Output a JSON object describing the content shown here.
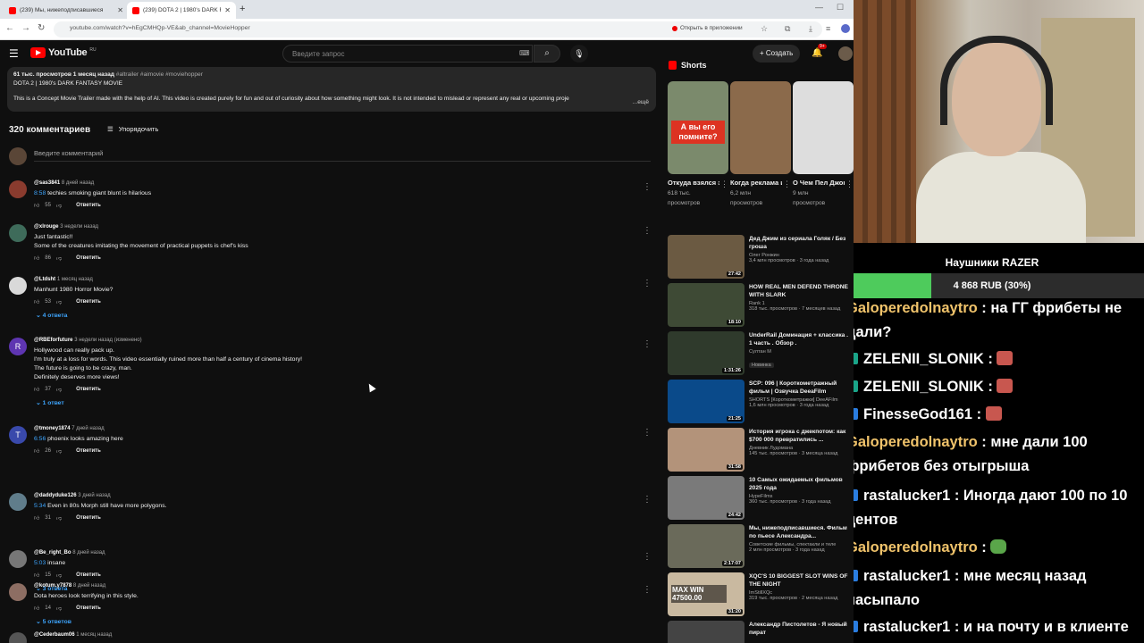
{
  "browser": {
    "tabs": [
      {
        "title": "(239) Мы, нижеподписавшиеся"
      },
      {
        "title": "(239) DOTA 2 | 1980's DARK FA"
      }
    ],
    "url": "youtube.com/watch?v=hEgCMHQp-VE&ab_channel=MovieHopper",
    "open_in_app": "Открыть в приложении"
  },
  "youtube": {
    "logo": "YouTube",
    "region": "RU",
    "search_placeholder": "Введите запрос",
    "create_label": "Создать",
    "notifications": "9+"
  },
  "description": {
    "meta": "61 тыс. просмотров  1 месяц назад",
    "tags": "#altrailer #aimovie #moviehopper",
    "title": "DOTA 2 | 1980's DARK FANTASY MOVIE",
    "text": "This is a Concept Movie Trailer made with the help of AI. This video is created purely for fun and out of curiosity about how something might look. It is not intended to mislead or represent any real or upcoming proje",
    "more": "...ещё"
  },
  "comments_header": {
    "count": "320 комментариев",
    "sort_label": "Упорядочить",
    "input_placeholder": "Введите комментарий"
  },
  "comments": [
    {
      "author": "@sas3841",
      "time": "8 дней назад",
      "ts": "8:58",
      "text": " techies smoking giant blunt is hilarious",
      "text2": "",
      "text3": "",
      "text4": "",
      "likes": "55",
      "reply": "Ответить",
      "replies": "",
      "avatar_letter": "",
      "avatar_color": "#8a3b2e"
    },
    {
      "author": "@xlrouge",
      "time": "3 недели назад",
      "ts": "",
      "text": "Just fantastic!!",
      "text2": "Some of the creatures imitating the movement of practical puppets is chef's kiss",
      "text3": "",
      "text4": "",
      "likes": "86",
      "reply": "Ответить",
      "replies": "",
      "avatar_letter": "",
      "avatar_color": "#3e6b5a"
    },
    {
      "author": "@Ltdsht",
      "time": "1 месяц назад",
      "ts": "",
      "text": "Manhunt 1980 Horror Movie?",
      "text2": "",
      "text3": "",
      "text4": "",
      "likes": "53",
      "reply": "Ответить",
      "replies": "4 ответа",
      "avatar_letter": "",
      "avatar_color": "#d9d9d9"
    },
    {
      "author": "@RBEforfuture",
      "time": "3 недели назад (изменено)",
      "ts": "",
      "text": "Hollywood can really pack up.",
      "text2": "I'm truly at a loss for words. This video essentially ruined more than half a century of cinema history!",
      "text3": "The future is going to be crazy, man.",
      "text4": "Definitely deserves more views!",
      "likes": "37",
      "reply": "Ответить",
      "replies": "1 ответ",
      "avatar_letter": "R",
      "avatar_color": "#5e35b1"
    },
    {
      "author": "@tmoney1874",
      "time": "7 дней назад",
      "ts": "6:56",
      "text": " phoenix looks amazing here",
      "text2": "",
      "text3": "",
      "text4": "",
      "likes": "26",
      "reply": "Ответить",
      "replies": "",
      "avatar_letter": "T",
      "avatar_color": "#3949ab"
    },
    {
      "author": "@daddyduke126",
      "time": "3 дней назад",
      "ts": "5:34",
      "text": " Even in 80s Morph still have more polygons.",
      "text2": "",
      "text3": "",
      "text4": "",
      "likes": "31",
      "reply": "Ответить",
      "replies": "",
      "avatar_letter": "",
      "avatar_color": "#607d8b"
    },
    {
      "author": "@Be_right_Bo",
      "time": "8 дней назад",
      "ts": "5:03",
      "text": " insane",
      "text2": "",
      "text3": "",
      "text4": "",
      "likes": "15",
      "reply": "Ответить",
      "replies": "3 ответа",
      "avatar_letter": "",
      "avatar_color": "#777"
    },
    {
      "author": "@kotum.y7878",
      "time": "8 дней назад",
      "ts": "",
      "text": "Dota heroes look terrifying in this style.",
      "text2": "",
      "text3": "",
      "text4": "",
      "likes": "14",
      "reply": "Ответить",
      "replies": "5 ответов",
      "avatar_letter": "",
      "avatar_color": "#8d6e63"
    },
    {
      "author": "@Cederbaum06",
      "time": "1 месяц назад",
      "ts": "",
      "text": "",
      "text2": "",
      "text3": "",
      "text4": "",
      "likes": "",
      "reply": "",
      "replies": "",
      "avatar_letter": "",
      "avatar_color": "#555"
    }
  ],
  "shorts": {
    "header": "Shorts",
    "items": [
      {
        "title": "Откуда взялся это...",
        "views1": "618 тыс.",
        "views2": "просмотров",
        "overlay": "А вы его помните?",
        "color": "#7b8a6c"
      },
      {
        "title": "Когда реклама и...",
        "views1": "6,2 млн",
        "views2": "просмотров",
        "overlay": "",
        "color": "#8b6a4b"
      },
      {
        "title": "О Чем Пел Джон ...",
        "views1": "9 млн",
        "views2": "просмотров",
        "overlay": "",
        "color": "#ddd"
      }
    ]
  },
  "recommended": [
    {
      "title": "Дед Джим из сериала Голяк / Без гроша",
      "channel": "Олег Ронжин",
      "meta": "3,4 млн просмотров · 3 года назад",
      "badge": "",
      "duration": "27:42",
      "color": "#6b5a42"
    },
    {
      "title": "HOW REAL MEN DEFEND THRONE WITH SLARK",
      "channel": "Rank 1",
      "meta": "318 тыс. просмотров · 7 месяцев назад",
      "badge": "",
      "duration": "18:10",
      "color": "#3e4a35"
    },
    {
      "title": "UnderRail Доминация + классика . 1 часть . Обзор .",
      "channel": "Султан М",
      "meta": "",
      "badge": "Новинка",
      "duration": "1:31:26",
      "color": "#2f3a2c"
    },
    {
      "title": "SCP: 096 | Короткометражный фильм | Озвучка DeeaFilm",
      "channel": "SHORTS [Короткометражки] DeeAFilm",
      "meta": "1,6 млн просмотров · 3 года назад",
      "badge": "",
      "duration": "21:25",
      "color": "#0a4a8a"
    },
    {
      "title": "История игрока с джекпотом: как $700 000 превратились ...",
      "channel": "Дневник Лудомана",
      "meta": "145 тыс. просмотров · 3 месяца назад",
      "badge": "",
      "duration": "31:58",
      "color": "#b3937a"
    },
    {
      "title": "10 Самых ожидаемых фильмов 2025 года",
      "channel": "HypeFilms",
      "meta": "360 тыс. просмотров · 3 года назад",
      "badge": "",
      "duration": "24:42",
      "color": "#7a7a7a"
    },
    {
      "title": "Мы, нижеподписавшиеся. Фильм по пьесе Александра...",
      "channel": "Советские фильмы, спектакли и теле",
      "meta": "2 млн просмотров · 3 года назад",
      "badge": "",
      "duration": "2:17:07",
      "color": "#6a6a5a"
    },
    {
      "title": "XQC'S 10 BIGGEST SLOT WINS OF THE NIGHT",
      "channel": "ImStillXQc",
      "meta": "319 тыс. просмотров · 2 месяца назад",
      "badge": "",
      "duration": "31:20",
      "color": "#c9b9a0",
      "overlay": "MAX WIN 47500.00"
    },
    {
      "title": "Александр Пистолетов - Я новый пират",
      "channel": "",
      "meta": "",
      "badge": "",
      "duration": "",
      "color": "#444"
    }
  ],
  "stream": {
    "goal_title": "Наушники RAZER",
    "goal_amount": "4 868 RUB (30%)",
    "goal_progress_pct": 30,
    "chat": [
      {
        "user": "Galoperedolnaytro",
        "sep": " : ",
        "text": "на ГГ фрибеты не дали?"
      },
      {
        "user": "ZELENII_SLONIK",
        "sep": " : ",
        "text": ""
      },
      {
        "user": "ZELENII_SLONIK",
        "sep": " : ",
        "text": ""
      },
      {
        "user": "FinesseGod161",
        "sep": " : ",
        "text": ""
      },
      {
        "user": "Galoperedolnaytro",
        "sep": " : ",
        "text": "мне дали 100 фрибетов без отыгрыша"
      },
      {
        "user": "rastalucker1",
        "sep": " : ",
        "text": "Иногда дают 100 по 10 центов"
      },
      {
        "user": "Galoperedolnaytro",
        "sep": " : ",
        "text": ""
      },
      {
        "user": "rastalucker1",
        "sep": " : ",
        "text": "мне месяц назад насыпало"
      },
      {
        "user": "rastalucker1",
        "sep": " : ",
        "text": "и на почту и в клиенте"
      }
    ]
  }
}
